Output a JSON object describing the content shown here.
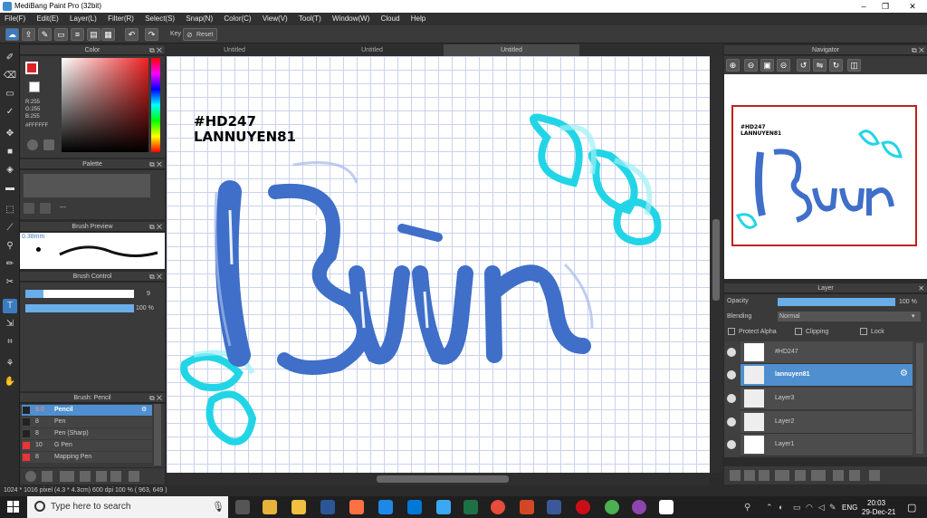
{
  "window": {
    "title": "MediBang Paint Pro (32bit)",
    "controls": [
      "–",
      "❐",
      "✕"
    ]
  },
  "menu": [
    "File(F)",
    "Edit(E)",
    "Layer(L)",
    "Filter(R)",
    "Select(S)",
    "Snap(N)",
    "Color(C)",
    "View(V)",
    "Tool(T)",
    "Window(W)",
    "Cloud",
    "Help"
  ],
  "toolbar": {
    "key_label": "Key",
    "reset_label": "Reset"
  },
  "color_panel": {
    "title": "Color",
    "r": "R:255",
    "g": "G:255",
    "b": "B:255",
    "hex": "#FFFFFF"
  },
  "palette_panel": {
    "title": "Palette",
    "placeholder": "---"
  },
  "brush_preview": {
    "title": "Brush Preview",
    "size": "0.38mm"
  },
  "brush_control": {
    "title": "Brush Control",
    "size_value": "9",
    "opacity_value": "100 %"
  },
  "brush_list": {
    "title": "Brush: Pencil",
    "items": [
      {
        "size": "9.0",
        "name": "Pencil"
      },
      {
        "size": "8",
        "name": "Pen"
      },
      {
        "size": "8",
        "name": "Pen (Sharp)"
      },
      {
        "size": "10",
        "name": "G Pen"
      },
      {
        "size": "8",
        "name": "Mapping Pen"
      }
    ]
  },
  "tabs": [
    "Untitled",
    "Untitled",
    "Untitled"
  ],
  "canvas": {
    "tag_line1": "#HD247",
    "tag_line2": "LANNUYEN81",
    "word": "Bún"
  },
  "navigator": {
    "title": "Navigator"
  },
  "layer_panel": {
    "title": "Layer",
    "opacity_label": "Opacity",
    "opacity_value": "100 %",
    "blending_label": "Blending",
    "blending_value": "Normal",
    "protect_alpha": "Protect Alpha",
    "clipping": "Clipping",
    "lock": "Lock",
    "layers": [
      "#HD247",
      "lannuyen81",
      "Layer3",
      "Layer2",
      "Layer1"
    ]
  },
  "status": {
    "text": "1024 * 1016 pixel   (4.3 * 4.3cm)   600 dpi   100 %   ( 963, 649 )"
  },
  "taskbar": {
    "search_placeholder": "Type here to search",
    "lang": "ENG",
    "time": "20:03",
    "date": "29-Dec-21"
  },
  "colors": {
    "accent": "#4f8fcf",
    "letter_blue": "#3f6fc8",
    "cyan": "#22d5e6"
  }
}
